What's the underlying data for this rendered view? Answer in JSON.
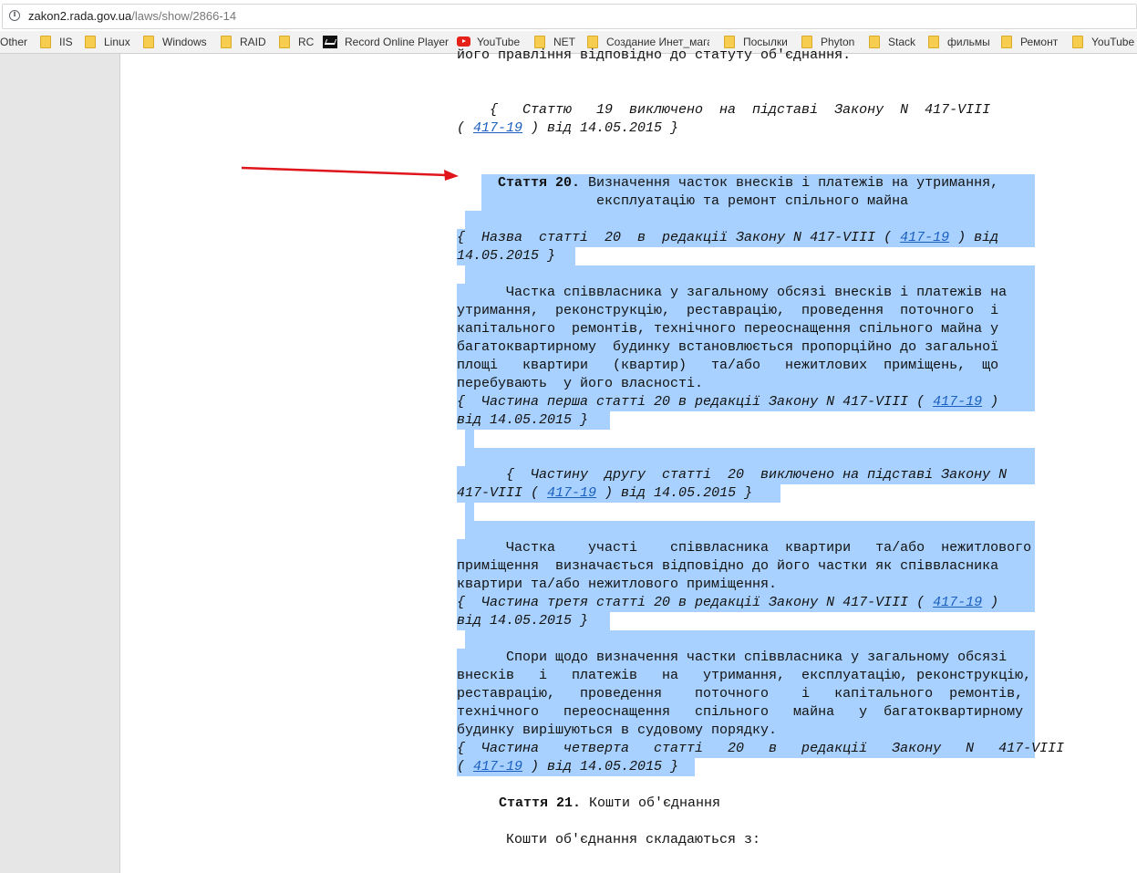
{
  "browser": {
    "url_host": "zakon2.rada.gov.ua",
    "url_path": "/laws/show/2866-14",
    "bookmarks": [
      {
        "label": "Other",
        "icon": "none"
      },
      {
        "label": "IIS",
        "icon": "folder-icon"
      },
      {
        "label": "Linux",
        "icon": "folder-icon"
      },
      {
        "label": "Windows",
        "icon": "folder-icon"
      },
      {
        "label": "RAID",
        "icon": "folder-icon"
      },
      {
        "label": "RC",
        "icon": "folder-icon"
      },
      {
        "label": "Record Online Player",
        "icon": "record-player-icon"
      },
      {
        "label": "YouTube",
        "icon": "youtube-icon"
      },
      {
        "label": "NET",
        "icon": "folder-icon"
      },
      {
        "label": "Создание Инет_мага",
        "icon": "folder-icon"
      },
      {
        "label": "Посылки",
        "icon": "folder-icon"
      },
      {
        "label": "Phyton",
        "icon": "folder-icon"
      },
      {
        "label": "Stack",
        "icon": "folder-icon"
      },
      {
        "label": "фильмы",
        "icon": "folder-icon"
      },
      {
        "label": "Ремонт",
        "icon": "folder-icon"
      },
      {
        "label": "YouTube",
        "icon": "folder-icon"
      }
    ]
  },
  "document": {
    "top_cut": "його правління відповідно до статуту об'єднання.",
    "art19_note_1": "    {   Статтю   19  виключено  на  підставі  Закону  N  417-VIII",
    "art19_note_2_pre": "( ",
    "link": "417-19",
    "art19_note_2_post": " ) від 14.05.2015 }",
    "art20_label": "Стаття 20.",
    "art20_title_1": " Визначення часток внесків і платежів на утримання,",
    "art20_title_2": "              експлуатацію та ремонт спільного майна ",
    "art20_note_1_pre": "{  Назва  статті  20  в  редакції Закону N 417-VIII ( ",
    "art20_note_1_post": " ) від",
    "art20_note_2": "14.05.2015 }",
    "p1_1": "      Частка співвласника у загальному обсязі внесків і платежів на",
    "p1_2": "утримання,  реконструкцію,  реставрацію,  проведення  поточного  і",
    "p1_3": "капітального  ремонтів, технічного переоснащення спільного майна у",
    "p1_4": "багатоквартирному  будинку встановлюється пропорційно до загальної",
    "p1_5": "площі   квартири   (квартир)   та/або   нежитлових  приміщень,  що",
    "p1_6": "перебувають  у його власності.",
    "p1_note_1_pre": "{  Частина перша статті 20 в редакції Закону N 417-VIII ( ",
    "p1_note_1_post": " )",
    "p1_note_2": "від 14.05.2015 }",
    "p2_note_1": "      {  Частину  другу  статті  20  виключено на підставі Закону N",
    "p2_note_2_pre": "417-VIII ( ",
    "p2_note_2_post": " ) від 14.05.2015 }",
    "p3_1": "      Частка    участі    співвласника  квартири   та/або  нежитлового",
    "p3_2": "приміщення  визначається відповідно до його частки як співвласника",
    "p3_3": "квартири та/або нежитлового приміщення.",
    "p3_note_1_pre": "{  Частина третя статті 20 в редакції Закону N 417-VIII ( ",
    "p3_note_1_post": " )",
    "p3_note_2": "від 14.05.2015 }",
    "p4_1": "      Спори щодо визначення частки співвласника у загальному обсязі",
    "p4_2": "внесків   і   платежів   на   утримання,  експлуатацію, реконструкцію,",
    "p4_3": "реставрацію,   проведення    поточного    і   капітального  ремонтів,",
    "p4_4": "технічного   переоснащення   спільного   майна   у  багатоквартирному",
    "p4_5": "будинку вирішуються в судовому порядку.",
    "p4_note_1": "{  Частина   четверта   статті   20   в   редакції   Закону   N   417-VIII",
    "p4_note_2_pre": "( ",
    "p4_note_2_post": " ) від 14.05.2015 }",
    "art21_label": "Стаття 21.",
    "art21_title": " Кошти об'єднання",
    "art21_p1": "      Кошти об'єднання складаються з:"
  },
  "colors": {
    "selection": "#a8d1ff",
    "link": "#1a5fc0",
    "arrow": "#e0141b"
  }
}
